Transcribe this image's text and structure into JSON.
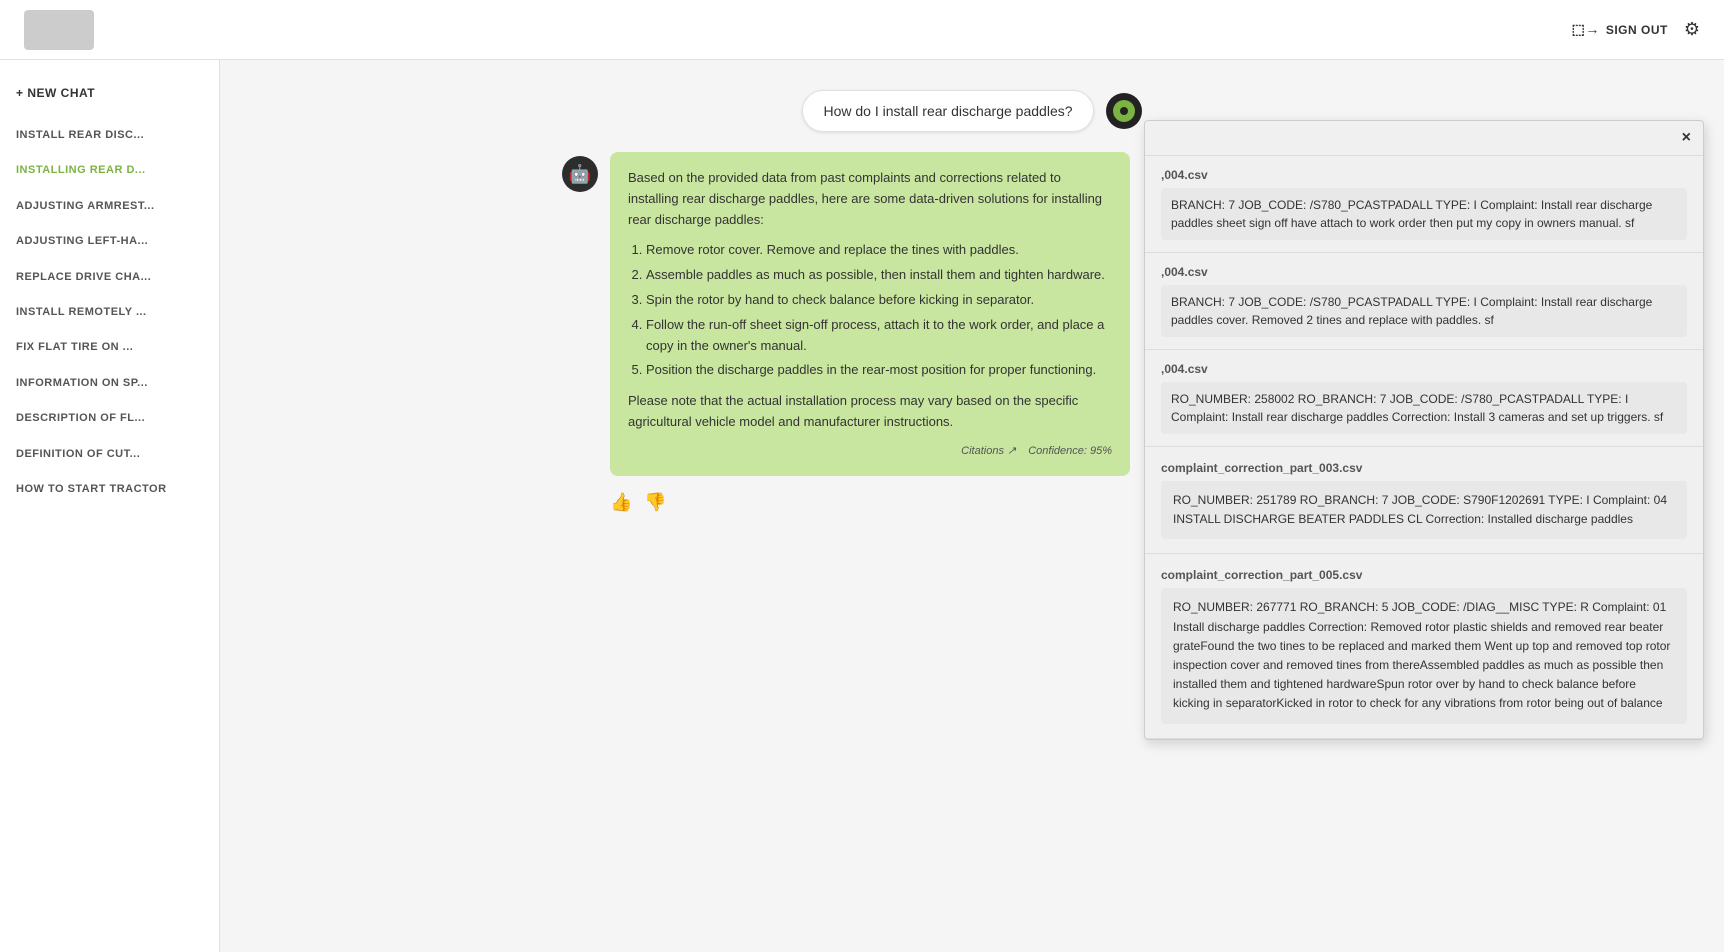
{
  "header": {
    "sign_out_label": "SIGN OUT",
    "logo_alt": "Logo"
  },
  "sidebar": {
    "new_chat_label": "+ NEW CHAT",
    "items": [
      {
        "id": "install-rear-disc",
        "label": "INSTALL REAR DISC...",
        "active": false
      },
      {
        "id": "installing-rear-d",
        "label": "INSTALLING REAR D...",
        "active": true
      },
      {
        "id": "adjusting-armrest",
        "label": "ADJUSTING ARMREST...",
        "active": false
      },
      {
        "id": "adjusting-left-ha",
        "label": "ADJUSTING LEFT-HA...",
        "active": false
      },
      {
        "id": "replace-drive-cha",
        "label": "REPLACE DRIVE CHA...",
        "active": false
      },
      {
        "id": "install-remotely",
        "label": "INSTALL REMOTELY ...",
        "active": false
      },
      {
        "id": "fix-flat-tire-on",
        "label": "FIX FLAT TIRE ON ...",
        "active": false
      },
      {
        "id": "information-on-sp",
        "label": "INFORMATION ON SP...",
        "active": false
      },
      {
        "id": "description-of-fl",
        "label": "DESCRIPTION OF FL...",
        "active": false
      },
      {
        "id": "definition-of-cut",
        "label": "DEFINITION OF CUT...",
        "active": false
      },
      {
        "id": "how-to-start-tractor",
        "label": "HOW TO START TRACTOR",
        "active": false
      }
    ]
  },
  "chat": {
    "user_message": "How do I install rear discharge paddles?",
    "ai_response": {
      "intro": "Based on the provided data from past complaints and corrections related to installing rear discharge paddles, here are some data-driven solutions for installing rear discharge paddles:",
      "steps": [
        "Remove rotor cover. Remove and replace the tines with paddles.",
        "Assemble paddles as much as possible, then install them and tighten hardware.",
        "Spin the rotor by hand to check balance before kicking in separator.",
        "Follow the run-off sheet sign-off process, attach it to the work order, and place a copy in the owner's manual.",
        "Position the discharge paddles in the rear-most position for proper functioning."
      ],
      "disclaimer": "Please note that the actual installation process may vary based on the specific agricultural vehicle model and manufacturer instructions.",
      "citations_label": "Citations ↗",
      "confidence_label": "Confidence: 95%"
    }
  },
  "citations_panel": {
    "close_label": "×",
    "items": [
      {
        "filename": ",004.csv",
        "text": "BRANCH: 7 JOB_CODE: /S780_PCASTPADALL TYPE: I Complaint: Install rear discharge paddles sheet sign off have attach to work order then put my copy in owners manual. sf"
      },
      {
        "filename": ",004.csv",
        "text": "BRANCH: 7 JOB_CODE: /S780_PCASTPADALL TYPE: I Complaint: Install rear discharge paddles cover. Removed 2 tines and replace with paddles. sf"
      },
      {
        "filename": ",004.csv",
        "text": "RO_NUMBER: 258002 RO_BRANCH: 7 JOB_CODE: /S780_PCASTPADALL TYPE: I Complaint: Install rear discharge paddles Correction: Install 3 cameras and set up triggers. sf"
      },
      {
        "filename": "complaint_correction_part_003.csv",
        "text": "RO_NUMBER: 251789 RO_BRANCH: 7 JOB_CODE: S790F1202691 TYPE: I Complaint: 04 INSTALL DISCHARGE BEATER PADDLES CL Correction: Installed discharge paddles"
      },
      {
        "filename": "complaint_correction_part_005.csv",
        "text": "RO_NUMBER: 267771 RO_BRANCH: 5 JOB_CODE: /DIAG__MISC TYPE: R Complaint: 01 Install discharge paddles Correction: Removed rotor plastic shields and removed rear beater grateFound the two tines to be replaced and marked them Went up top and removed top rotor inspection cover and removed tines from thereAssembled paddles as much as possible then installed them and tightened hardwareSpun rotor over by hand to check balance before kicking in separatorKicked in rotor to check for any vibrations from rotor being out of balance"
      }
    ]
  }
}
